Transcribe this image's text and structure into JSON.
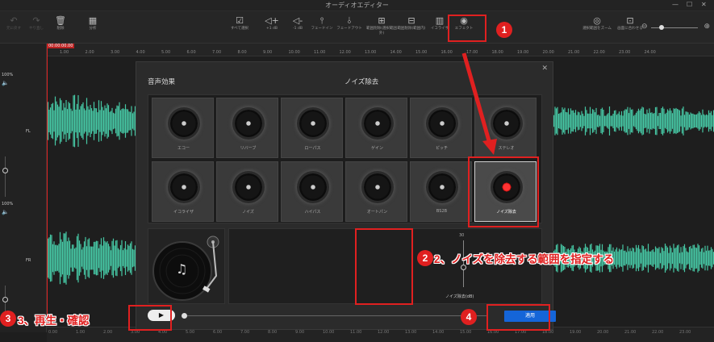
{
  "app": {
    "title": "オーディオエディター",
    "win_min": "—",
    "win_max": "☐",
    "win_close": "✕"
  },
  "toolbar": {
    "undo": "元に戻す",
    "redo": "やり直し",
    "delete": "削除",
    "analyze": "分析",
    "select_all": "すべて選択",
    "vol_up": "+1 dB",
    "vol_down": "-1 dB",
    "fade_in": "フェードイン",
    "fade_out": "フェードアウト",
    "delete_selected": "範囲削除(選択範囲外)",
    "delete_range": "範囲削除(範囲内)",
    "equalizer": "イコライザ",
    "effects": "エフェクト",
    "zoom_sel": "選択範囲をズーム",
    "zoom_fit": "画面に合わせる",
    "zoom_minus": "⊖",
    "zoom_plus": "⊕"
  },
  "ruler": {
    "current": "00:00:00.00",
    "ticks": [
      "1.00",
      "2.00",
      "3.00",
      "4.00",
      "5.00",
      "6.00",
      "7.00",
      "8.00",
      "9.00",
      "10.00",
      "11.00",
      "12.00",
      "13.00",
      "14.00",
      "15.00",
      "16.00",
      "17.00",
      "18.00",
      "19.00",
      "20.00",
      "21.00",
      "22.00",
      "23.00",
      "24.00"
    ]
  },
  "bottom_ruler": {
    "ticks": [
      "0.00",
      "1.00",
      "2.00",
      "3.00",
      "4.00",
      "5.00",
      "6.00",
      "7.00",
      "8.00",
      "9.00",
      "10.00",
      "11.00",
      "12.00",
      "13.00",
      "14.00",
      "15.00",
      "16.00",
      "17.00",
      "18.00",
      "19.00",
      "20.00",
      "21.00",
      "22.00",
      "23.00"
    ]
  },
  "tracks": {
    "left_label": "FL",
    "right_label": "FR",
    "level_top": "100%",
    "level_bottom": "100%",
    "wave_color": "#46c7a4"
  },
  "dialog": {
    "close": "✕",
    "heading_left": "音声効果",
    "heading_right": "ノイズ除去",
    "effects": [
      "エコー",
      "リバーブ",
      "ローパス",
      "ゲイン",
      "ピッチ",
      "ステレオ",
      "イコライザ",
      "ノイズ",
      "ハイパス",
      "オートパン",
      "BS2B",
      "ノイズ除去"
    ],
    "selected_effect": "ノイズ除去",
    "param_value": "30",
    "param_label": "ノイズ除去(dB)",
    "play_icon": "▶",
    "apply": "適用",
    "note_icon": "♫"
  },
  "annotations": {
    "n1": "1",
    "n2": "2",
    "n3": "3",
    "n4": "4",
    "text2": "2、ノイズを除去する範囲を指定する",
    "text3": "3、再生・確認",
    "color": "#e02020"
  }
}
